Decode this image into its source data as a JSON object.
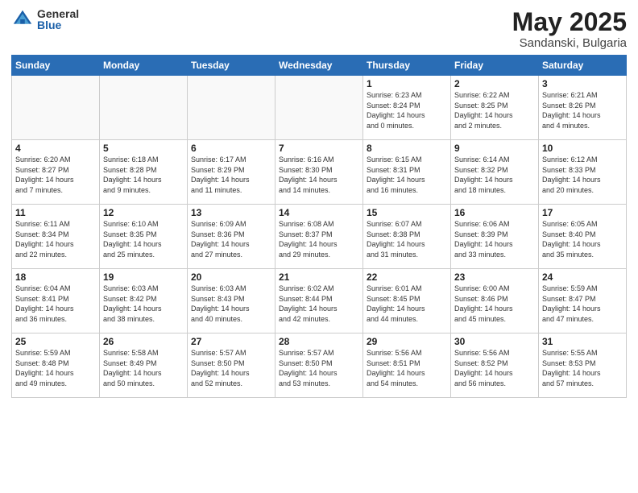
{
  "header": {
    "logo_general": "General",
    "logo_blue": "Blue",
    "month": "May 2025",
    "location": "Sandanski, Bulgaria"
  },
  "days_of_week": [
    "Sunday",
    "Monday",
    "Tuesday",
    "Wednesday",
    "Thursday",
    "Friday",
    "Saturday"
  ],
  "weeks": [
    [
      {
        "day": "",
        "info": ""
      },
      {
        "day": "",
        "info": ""
      },
      {
        "day": "",
        "info": ""
      },
      {
        "day": "",
        "info": ""
      },
      {
        "day": "1",
        "info": "Sunrise: 6:23 AM\nSunset: 8:24 PM\nDaylight: 14 hours\nand 0 minutes."
      },
      {
        "day": "2",
        "info": "Sunrise: 6:22 AM\nSunset: 8:25 PM\nDaylight: 14 hours\nand 2 minutes."
      },
      {
        "day": "3",
        "info": "Sunrise: 6:21 AM\nSunset: 8:26 PM\nDaylight: 14 hours\nand 4 minutes."
      }
    ],
    [
      {
        "day": "4",
        "info": "Sunrise: 6:20 AM\nSunset: 8:27 PM\nDaylight: 14 hours\nand 7 minutes."
      },
      {
        "day": "5",
        "info": "Sunrise: 6:18 AM\nSunset: 8:28 PM\nDaylight: 14 hours\nand 9 minutes."
      },
      {
        "day": "6",
        "info": "Sunrise: 6:17 AM\nSunset: 8:29 PM\nDaylight: 14 hours\nand 11 minutes."
      },
      {
        "day": "7",
        "info": "Sunrise: 6:16 AM\nSunset: 8:30 PM\nDaylight: 14 hours\nand 14 minutes."
      },
      {
        "day": "8",
        "info": "Sunrise: 6:15 AM\nSunset: 8:31 PM\nDaylight: 14 hours\nand 16 minutes."
      },
      {
        "day": "9",
        "info": "Sunrise: 6:14 AM\nSunset: 8:32 PM\nDaylight: 14 hours\nand 18 minutes."
      },
      {
        "day": "10",
        "info": "Sunrise: 6:12 AM\nSunset: 8:33 PM\nDaylight: 14 hours\nand 20 minutes."
      }
    ],
    [
      {
        "day": "11",
        "info": "Sunrise: 6:11 AM\nSunset: 8:34 PM\nDaylight: 14 hours\nand 22 minutes."
      },
      {
        "day": "12",
        "info": "Sunrise: 6:10 AM\nSunset: 8:35 PM\nDaylight: 14 hours\nand 25 minutes."
      },
      {
        "day": "13",
        "info": "Sunrise: 6:09 AM\nSunset: 8:36 PM\nDaylight: 14 hours\nand 27 minutes."
      },
      {
        "day": "14",
        "info": "Sunrise: 6:08 AM\nSunset: 8:37 PM\nDaylight: 14 hours\nand 29 minutes."
      },
      {
        "day": "15",
        "info": "Sunrise: 6:07 AM\nSunset: 8:38 PM\nDaylight: 14 hours\nand 31 minutes."
      },
      {
        "day": "16",
        "info": "Sunrise: 6:06 AM\nSunset: 8:39 PM\nDaylight: 14 hours\nand 33 minutes."
      },
      {
        "day": "17",
        "info": "Sunrise: 6:05 AM\nSunset: 8:40 PM\nDaylight: 14 hours\nand 35 minutes."
      }
    ],
    [
      {
        "day": "18",
        "info": "Sunrise: 6:04 AM\nSunset: 8:41 PM\nDaylight: 14 hours\nand 36 minutes."
      },
      {
        "day": "19",
        "info": "Sunrise: 6:03 AM\nSunset: 8:42 PM\nDaylight: 14 hours\nand 38 minutes."
      },
      {
        "day": "20",
        "info": "Sunrise: 6:03 AM\nSunset: 8:43 PM\nDaylight: 14 hours\nand 40 minutes."
      },
      {
        "day": "21",
        "info": "Sunrise: 6:02 AM\nSunset: 8:44 PM\nDaylight: 14 hours\nand 42 minutes."
      },
      {
        "day": "22",
        "info": "Sunrise: 6:01 AM\nSunset: 8:45 PM\nDaylight: 14 hours\nand 44 minutes."
      },
      {
        "day": "23",
        "info": "Sunrise: 6:00 AM\nSunset: 8:46 PM\nDaylight: 14 hours\nand 45 minutes."
      },
      {
        "day": "24",
        "info": "Sunrise: 5:59 AM\nSunset: 8:47 PM\nDaylight: 14 hours\nand 47 minutes."
      }
    ],
    [
      {
        "day": "25",
        "info": "Sunrise: 5:59 AM\nSunset: 8:48 PM\nDaylight: 14 hours\nand 49 minutes."
      },
      {
        "day": "26",
        "info": "Sunrise: 5:58 AM\nSunset: 8:49 PM\nDaylight: 14 hours\nand 50 minutes."
      },
      {
        "day": "27",
        "info": "Sunrise: 5:57 AM\nSunset: 8:50 PM\nDaylight: 14 hours\nand 52 minutes."
      },
      {
        "day": "28",
        "info": "Sunrise: 5:57 AM\nSunset: 8:50 PM\nDaylight: 14 hours\nand 53 minutes."
      },
      {
        "day": "29",
        "info": "Sunrise: 5:56 AM\nSunset: 8:51 PM\nDaylight: 14 hours\nand 54 minutes."
      },
      {
        "day": "30",
        "info": "Sunrise: 5:56 AM\nSunset: 8:52 PM\nDaylight: 14 hours\nand 56 minutes."
      },
      {
        "day": "31",
        "info": "Sunrise: 5:55 AM\nSunset: 8:53 PM\nDaylight: 14 hours\nand 57 minutes."
      }
    ]
  ]
}
